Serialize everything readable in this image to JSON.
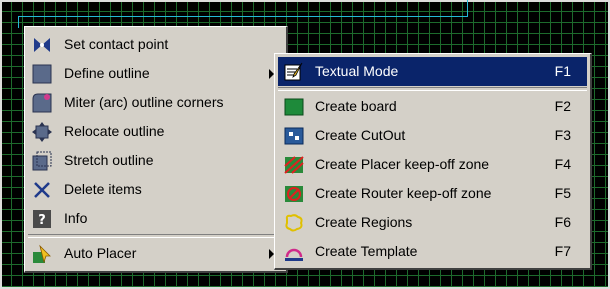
{
  "main_menu": {
    "items": [
      {
        "label": "Set contact point",
        "icon": "contact-point-icon"
      },
      {
        "label": "Define outline",
        "icon": "outline-icon",
        "has_submenu": true
      },
      {
        "label": "Miter (arc) outline corners",
        "icon": "miter-corners-icon"
      },
      {
        "label": "Relocate outline",
        "icon": "relocate-icon"
      },
      {
        "label": "Stretch outline",
        "icon": "stretch-icon"
      },
      {
        "label": "Delete items",
        "icon": "delete-icon"
      },
      {
        "label": "Info",
        "icon": "info-icon"
      },
      {
        "label": "Auto Placer",
        "icon": "auto-placer-icon",
        "has_submenu": true
      }
    ]
  },
  "sub_menu": {
    "items": [
      {
        "label": "Textual Mode",
        "key": "F1",
        "icon": "textual-mode-icon",
        "selected": true
      },
      {
        "label": "Create board",
        "key": "F2",
        "icon": "board-icon"
      },
      {
        "label": "Create CutOut",
        "key": "F3",
        "icon": "cutout-icon"
      },
      {
        "label": "Create Placer keep-off zone",
        "key": "F4",
        "icon": "placer-keepoff-icon"
      },
      {
        "label": "Create Router keep-off zone",
        "key": "F5",
        "icon": "router-keepoff-icon"
      },
      {
        "label": "Create Regions",
        "key": "F6",
        "icon": "regions-icon"
      },
      {
        "label": "Create Template",
        "key": "F7",
        "icon": "template-icon"
      }
    ]
  },
  "colors": {
    "menu_bg": "#d4d0c8",
    "highlight": "#0a246a",
    "grid": "#1d6a2c",
    "canvas": "#000000"
  }
}
